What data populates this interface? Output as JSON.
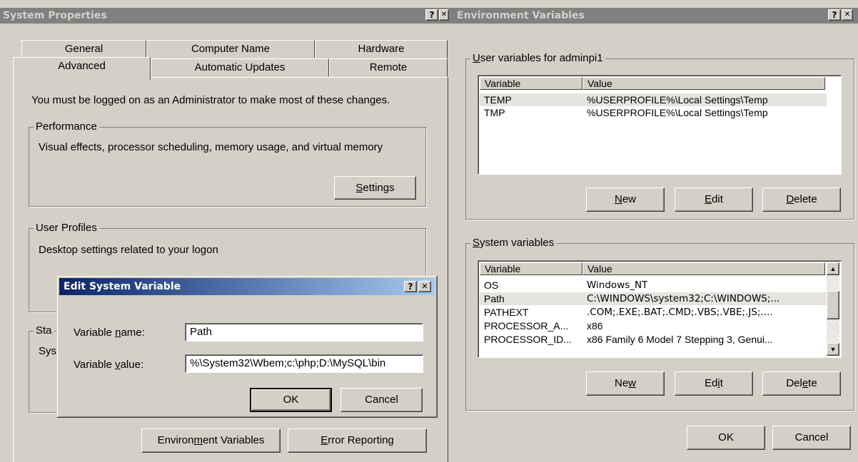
{
  "system_properties": {
    "title": "System Properties",
    "help_glyph": "?",
    "close_glyph": "✕",
    "tabs_row1": [
      "General",
      "Computer Name",
      "Hardware"
    ],
    "tabs_row2": [
      "Advanced",
      "Automatic Updates",
      "Remote"
    ],
    "admin_note": "You must be logged on as an Administrator to make most of these changes.",
    "performance": {
      "label": "Performance",
      "desc": "Visual effects, processor scheduling, memory usage, and virtual memory",
      "settings_label": "Settings"
    },
    "user_profiles": {
      "label": "User Profiles",
      "desc": "Desktop settings related to your logon"
    },
    "startup": {
      "label_partial": "Sta",
      "desc_partial": "Sys"
    },
    "env_vars_button": "Environment Variables",
    "error_reporting_button": "Error Reporting"
  },
  "environment_variables": {
    "title": "Environment Variables",
    "help_glyph": "?",
    "close_glyph": "✕",
    "user_group_label": "User variables for adminpi1",
    "columns": [
      "Variable",
      "Value"
    ],
    "user_vars": [
      {
        "name": "TEMP",
        "value": "%USERPROFILE%\\Local Settings\\Temp"
      },
      {
        "name": "TMP",
        "value": "%USERPROFILE%\\Local Settings\\Temp"
      }
    ],
    "user_buttons": [
      "New",
      "Edit",
      "Delete"
    ],
    "system_group_label": "System variables",
    "system_vars": [
      {
        "name": "OS",
        "value": "Windows_NT"
      },
      {
        "name": "Path",
        "value": "C:\\WINDOWS\\system32;C:\\WINDOWS;..."
      },
      {
        "name": "PATHEXT",
        "value": ".COM;.EXE;.BAT;.CMD;.VBS;.VBE;.JS;...."
      },
      {
        "name": "PROCESSOR_A...",
        "value": "x86"
      },
      {
        "name": "PROCESSOR_ID...",
        "value": "x86 Family 6 Model 7 Stepping 3, Genui..."
      }
    ],
    "system_buttons": [
      "New",
      "Edit",
      "Delete"
    ],
    "ok_label": "OK",
    "cancel_label": "Cancel"
  },
  "edit_system_variable": {
    "title": "Edit System Variable",
    "help_glyph": "?",
    "close_glyph": "✕",
    "name_label": "Variable name:",
    "name_value": "Path",
    "value_label": "Variable value:",
    "value_value": "%\\System32\\Wbem;c:\\php;D:\\MySQL\\bin",
    "ok_label": "OK",
    "cancel_label": "Cancel"
  },
  "colors": {
    "dialog_face": "#d4d0c8",
    "active_title": "#0a246a",
    "inactive_title": "#808080",
    "selection_inactive": "#e6e4de"
  }
}
